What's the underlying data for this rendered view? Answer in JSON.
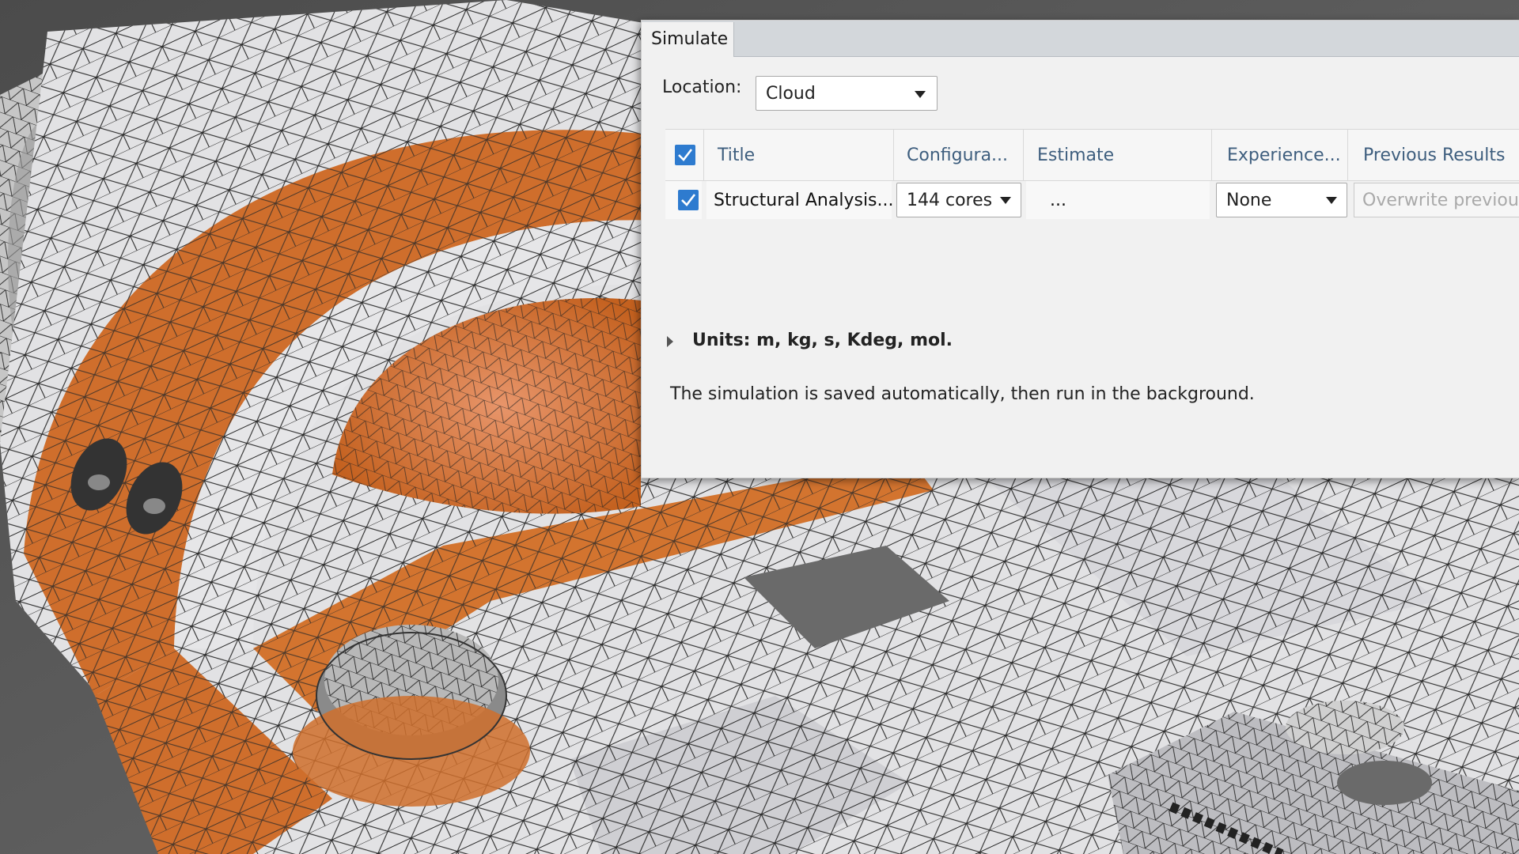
{
  "dialog": {
    "tab_label": "Simulate",
    "location": {
      "label": "Location:",
      "value": "Cloud"
    },
    "table": {
      "columns": [
        "Title",
        "Configura...",
        "Estimate",
        "Experience...",
        "Previous Results"
      ],
      "header_checked": true,
      "rows": [
        {
          "checked": true,
          "title": "Structural Analysis...",
          "configuration": "144 cores",
          "estimate": "...",
          "experience": "None",
          "previous_results_placeholder": "Overwrite previous"
        }
      ]
    },
    "units_label": "Units: m, kg, s, Kdeg, mol.",
    "info_text": "The simulation is saved automatically, then run in the background."
  },
  "colors": {
    "accent": "#2e7bcf",
    "header_text": "#3e5e7e",
    "model_orange": "#cf6e2c",
    "mesh_white": "#ececec",
    "background": "#5a5a5a"
  }
}
